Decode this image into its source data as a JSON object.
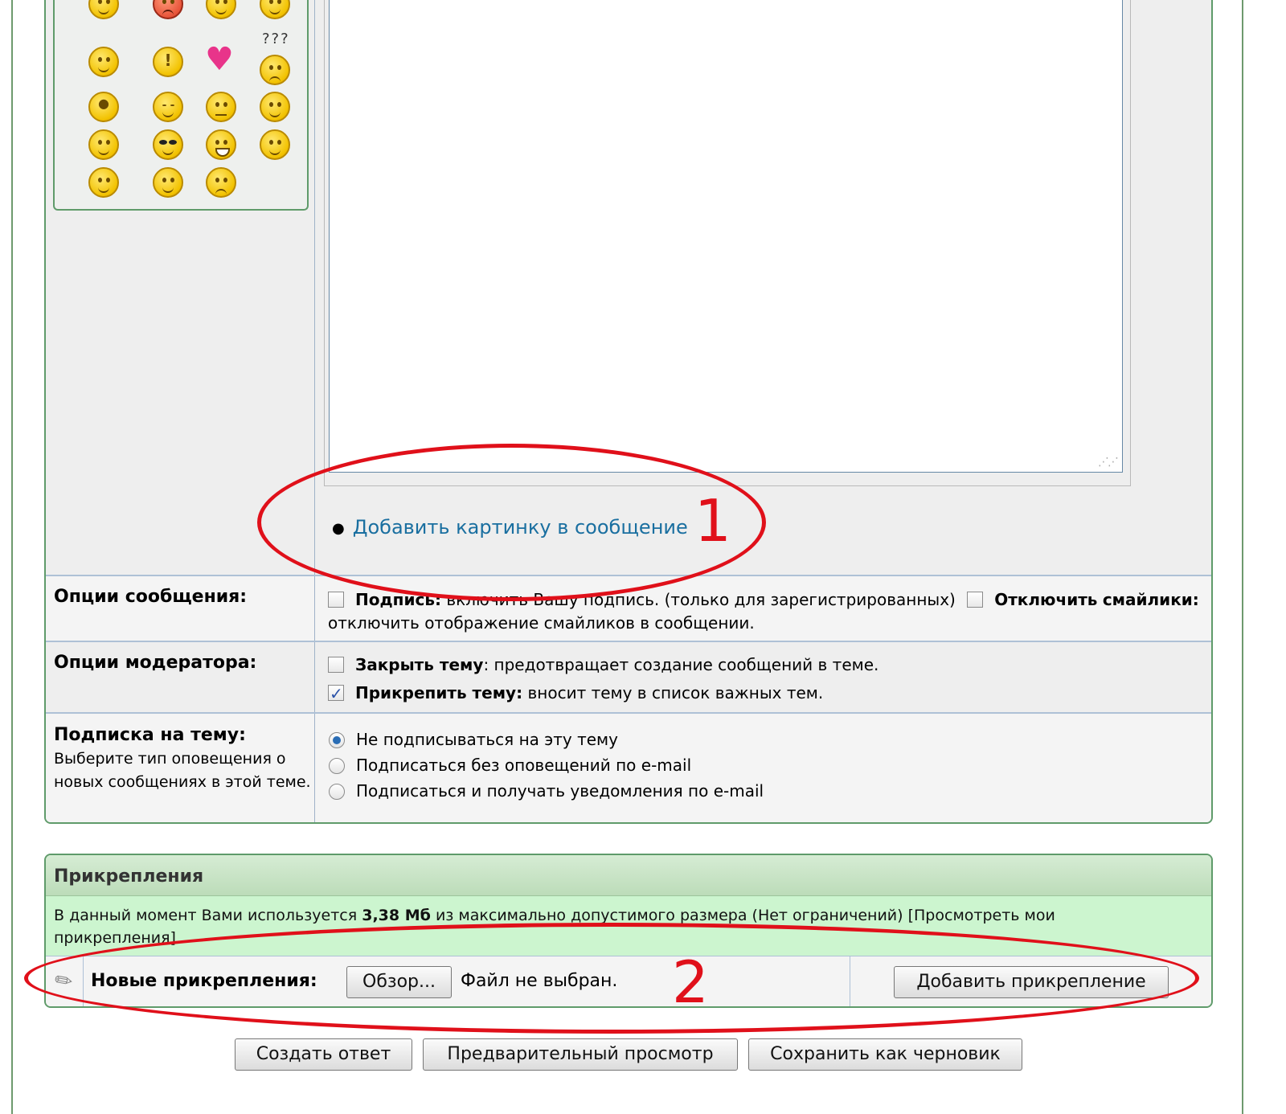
{
  "editor": {
    "insert_image_link": "Добавить картинку в сообщение",
    "smilies": [
      {
        "icon": "angel-smiley-icon"
      },
      {
        "icon": "angry-smiley-icon"
      },
      {
        "icon": "confused-smiley-icon"
      },
      {
        "icon": "rolleyes-smiley-icon"
      },
      {
        "icon": "cool-smiley-icon"
      },
      {
        "icon": "exclamation-smiley-icon"
      },
      {
        "icon": "heart-icon"
      },
      {
        "icon": "question-smiley-icon",
        "label": "???"
      },
      {
        "icon": "idea-smiley-icon"
      },
      {
        "icon": "sleepy-smiley-icon"
      },
      {
        "icon": "hmm-smiley-icon"
      },
      {
        "icon": "smile-smiley-icon"
      },
      {
        "icon": "happy-smiley-icon"
      },
      {
        "icon": "sunglasses-smiley-icon"
      },
      {
        "icon": "grin-smiley-icon"
      },
      {
        "icon": "tongue-smiley-icon"
      },
      {
        "icon": "rolleyes2-smiley-icon"
      },
      {
        "icon": "blush-smiley-icon"
      },
      {
        "icon": "sad-smiley-icon"
      }
    ]
  },
  "message_options": {
    "label": "Опции сообщения:",
    "signature_bold": "Подпись:",
    "signature_text": "включить Вашу подпись. (только для зарегистрированных)",
    "disable_smilies_bold_1": "Отключить",
    "disable_smilies_bold_2": "смайлики:",
    "disable_smilies_text": "отключить отображение смайликов в сообщении."
  },
  "moderator_options": {
    "label": "Опции модератора:",
    "close_bold": "Закрыть тему",
    "close_text": ": предотвращает создание сообщений в теме.",
    "sticky_bold": "Прикрепить тему:",
    "sticky_text": "вносит тему в список важных тем.",
    "sticky_checked": true
  },
  "subscription": {
    "label": "Подписка на тему:",
    "description": "Выберите тип оповещения о новых сообщениях в этой теме.",
    "options": [
      "Не подписываться на эту тему",
      "Подписаться без оповещений по e-mail",
      "Подписаться и получать уведомления по e-mail"
    ],
    "selected_index": 0
  },
  "attachments": {
    "title": "Прикрепления",
    "info_prefix": "В данный момент Вами используется",
    "info_size": "3,38 Мб",
    "info_suffix": "из максимально допустимого размера (Нет ограничений) [Просмотреть мои прикрепления]",
    "new_label": "Новые прикрепления:",
    "browse_button": "Обзор...",
    "no_file": "Файл не выбран.",
    "add_button": "Добавить прикрепление"
  },
  "actions": {
    "submit": "Создать ответ",
    "preview": "Предварительный просмотр",
    "save_draft": "Сохранить как черновик"
  },
  "annotations": {
    "marker_1": "1",
    "marker_2": "2",
    "color": "#e0101a"
  }
}
